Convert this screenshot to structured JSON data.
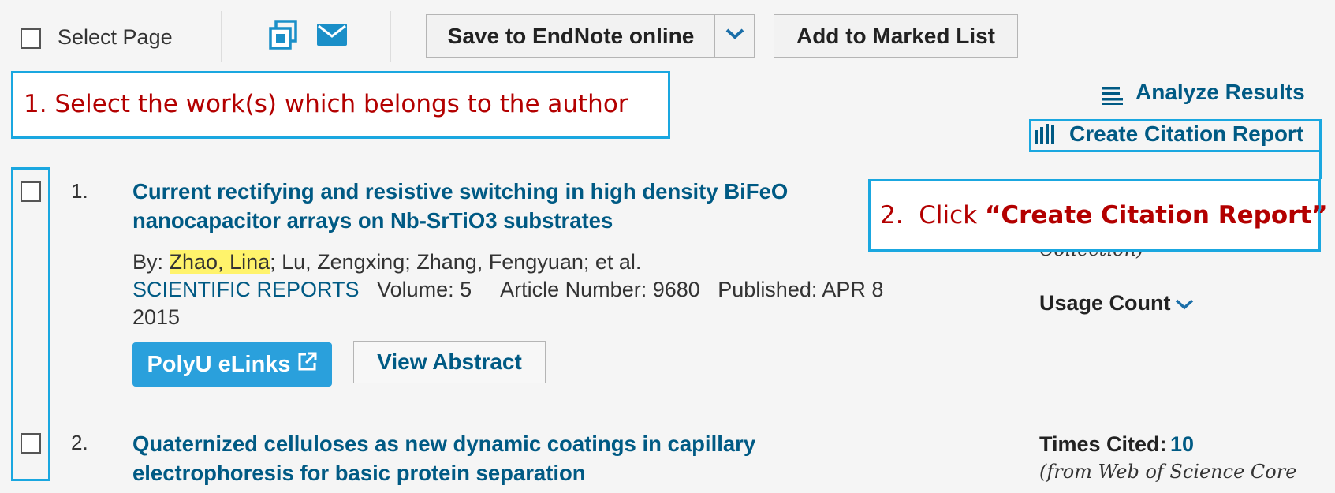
{
  "toolbar": {
    "select_page_label": "Select Page",
    "save_button_label": "Save to EndNote online",
    "add_marked_label": "Add to Marked List",
    "print_icon": "print-icon",
    "email_icon": "email-icon"
  },
  "annotations": {
    "step1": "1. Select the work(s) which belongs to the author",
    "step2_prefix": "2.  Click ",
    "step2_bold": "“Create Citation Report”"
  },
  "right_panel": {
    "analyze_label": "Analyze Results",
    "citation_report_label": "Create Citation Report",
    "collection_partial": "Collection)",
    "usage_count_label": "Usage Count",
    "times_cited_label": "Times Cited:",
    "times_cited_value": "10",
    "from_wos": "(from Web of Science Core"
  },
  "records": [
    {
      "number": "1.",
      "title_line1": "Current rectifying and resistive switching in high density BiFeO",
      "title_line2": "nanocapacitor arrays on Nb-SrTiO3 substrates",
      "by_prefix": "By: ",
      "author_highlight": "Zhao, Lina",
      "authors_rest": "; Lu, Zengxing; Zhang, Fengyuan; et al.",
      "journal": "SCIENTIFIC REPORTS",
      "details": "Volume: 5     Article Number: 9680   Published: APR 8",
      "year": "2015",
      "elinks_label": "PolyU eLinks",
      "view_abstract_label": "View Abstract"
    },
    {
      "number": "2.",
      "title_line1": "Quaternized celluloses as new dynamic coatings in capillary",
      "title_line2": "electrophoresis for basic protein separation"
    }
  ],
  "colors": {
    "annotation_border": "#1aa7e0",
    "annotation_text": "#b30000",
    "link": "#005a84",
    "highlight": "#fff36b"
  }
}
